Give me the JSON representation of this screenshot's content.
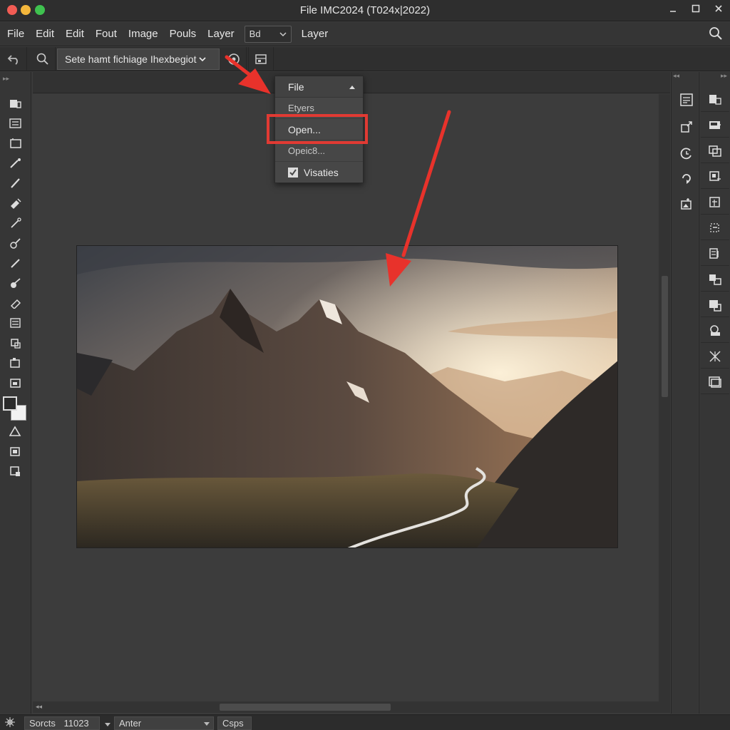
{
  "window": {
    "title": "File IMC2024 (T024x|2022)",
    "controls": [
      "minimize-icon",
      "maximize-icon",
      "close-icon"
    ]
  },
  "menubar": {
    "items": [
      "File",
      "Edit",
      "Edit",
      "Fout",
      "Image",
      "Pouls",
      "Layer"
    ],
    "select_value": "Bd",
    "after_select": "Layer"
  },
  "options": {
    "select_value": "Sete hamt fichiage Ihexbegiot"
  },
  "dropdown": {
    "header": "File",
    "items": [
      "Etyers",
      "Open...",
      "Opeic8...",
      "Visaties"
    ],
    "highlighted": "Open..."
  },
  "status": {
    "label": "Sorcts",
    "value": "11023",
    "select_value": "Anter",
    "button": "Csps"
  },
  "colors": {
    "highlight": "#e13a33",
    "arrow": "#e8322b",
    "foreground_swatch": "#2b2b2b",
    "background_swatch": "#f2f2f2"
  },
  "icons": {
    "toolbar": [
      "move-tool-icon",
      "marquee-tool-icon",
      "lasso-tool-icon",
      "magic-wand-icon",
      "brush-tool-icon",
      "healing-brush-icon",
      "eyedropper-icon",
      "clone-stamp-icon",
      "pencil-tool-icon",
      "eraser-icon",
      "paint-bucket-icon",
      "text-tool-icon",
      "crop-tool-icon",
      "frame-tool-icon",
      "path-select-icon",
      "shape-tool-icon",
      "hand-tool-icon",
      "zoom-tool-icon"
    ],
    "panel_a": [
      "properties-icon",
      "adjust-icon",
      "history-icon",
      "refresh-icon",
      "image-icon"
    ],
    "panel_b": [
      "layers-icon",
      "add-layer-icon",
      "duplicate-icon",
      "channels-icon",
      "paths-icon",
      "transform-icon",
      "layer-comps-icon",
      "swatches-icon",
      "styles-icon",
      "navigator-icon",
      "info-icon",
      "artboard-icon"
    ]
  }
}
